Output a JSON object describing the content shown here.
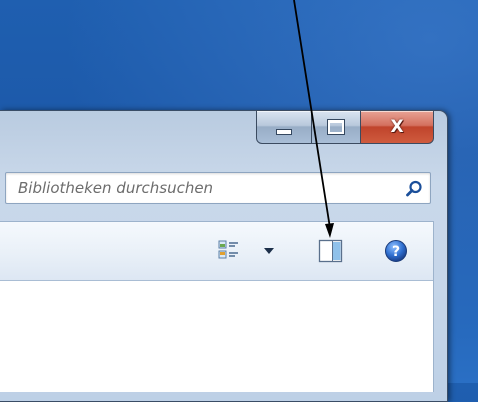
{
  "window": {
    "caption_buttons": {
      "minimize_icon": "minimize-icon",
      "maximize_icon": "maximize-icon",
      "close_label": "X"
    }
  },
  "search": {
    "placeholder": "Bibliotheken durchsuchen",
    "icon": "search-icon"
  },
  "toolbar": {
    "views_icon": "views-icon",
    "views_dropdown_icon": "chevron-down-icon",
    "preview_pane_icon": "preview-pane-icon",
    "help_icon": "help-icon"
  },
  "colors": {
    "desktop": "#1f5fb0",
    "close_button": "#c7472f",
    "help_blue": "#2f6fd0"
  }
}
